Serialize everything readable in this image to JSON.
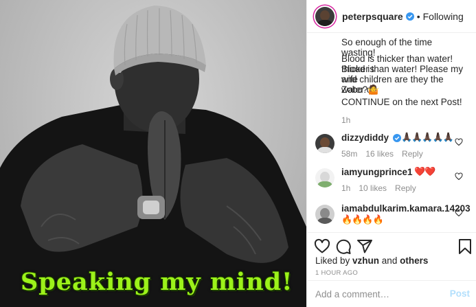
{
  "photo": {
    "caption": "Speaking my mind!",
    "caption_color": "#9cf21a"
  },
  "header": {
    "username": "peterpsquare",
    "separator": "•",
    "follow_state": "Following"
  },
  "post_caption": {
    "lines": [
      "So enough of the time wasting!",
      "",
      "Blood is thicker than water! Blood is",
      "thicker than water! Please my wife",
      "and children are they the water or",
      "Zobo?🤷",
      "",
      "CONTINUE on the next Post!"
    ],
    "time": "1h"
  },
  "comments": [
    {
      "username": "dizzydiddy",
      "verified": true,
      "text": "🙏🏿🙏🏿🙏🏿🙏🏿🙏🏿",
      "time": "58m",
      "likes": "16 likes",
      "reply": "Reply"
    },
    {
      "username": "iamyungprince1",
      "verified": false,
      "text": "❤️❤️",
      "time": "1h",
      "likes": "10 likes",
      "reply": "Reply"
    },
    {
      "username": "iamabdulkarim.kamara.14203",
      "verified": false,
      "text": "🔥🔥🔥🔥",
      "time": "",
      "likes": "",
      "reply": ""
    }
  ],
  "actions": {
    "icons": [
      "heart-icon",
      "comment-icon",
      "share-icon",
      "bookmark-icon"
    ],
    "liked_by_prefix": "Liked by ",
    "liked_by_user": "vzhun",
    "liked_by_suffix": " and ",
    "liked_by_others": "others",
    "post_time": "1 HOUR AGO"
  },
  "composer": {
    "placeholder": "Add a comment…",
    "post_label": "Post"
  },
  "colors": {
    "verified_blue": "#3897f0",
    "heart_red": "#ed4956",
    "post_button_disabled": "#b2dffc",
    "muted_text": "#8e8e8e"
  }
}
